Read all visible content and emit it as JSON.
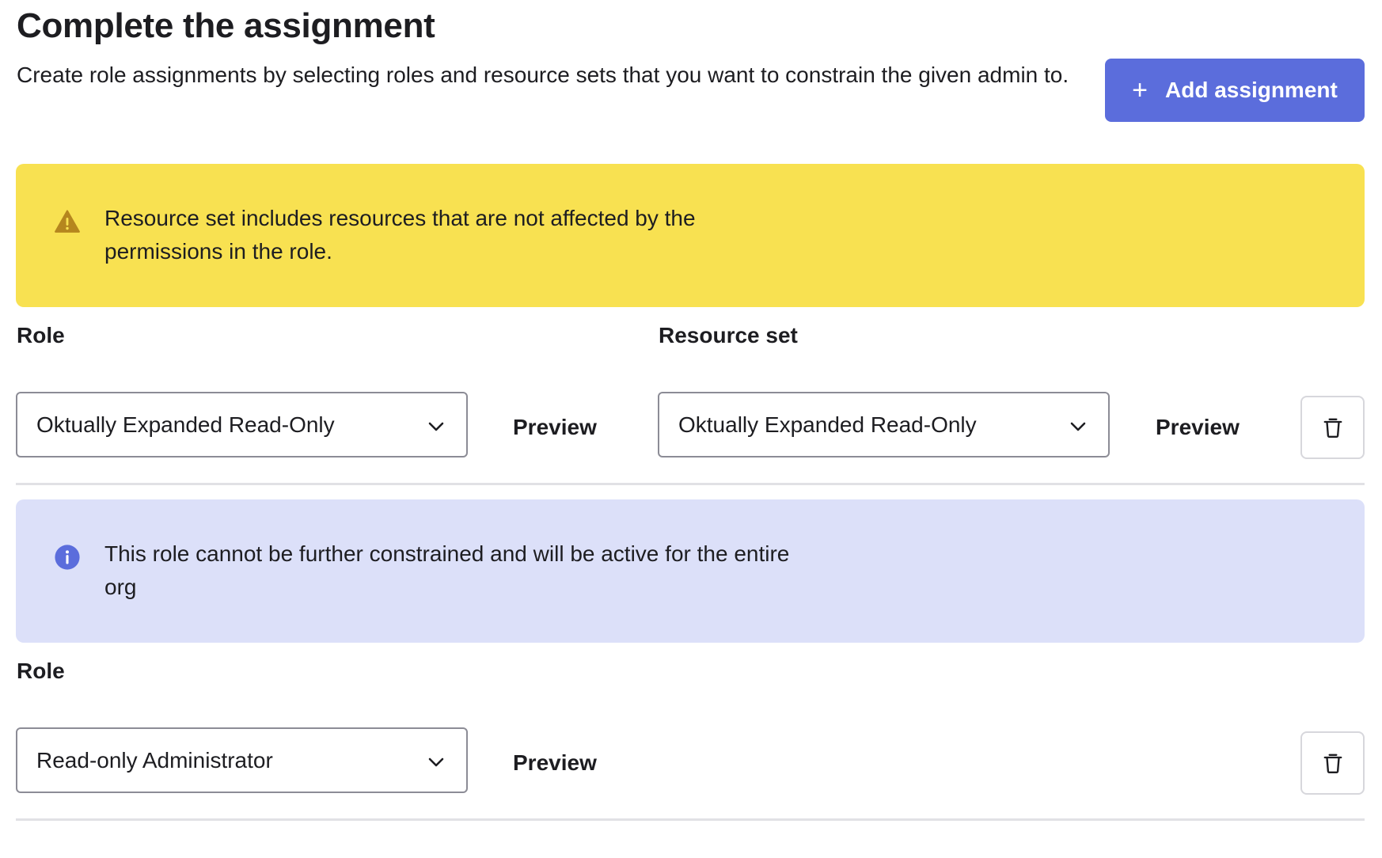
{
  "header": {
    "title": "Complete the assignment",
    "description": "Create role assignments by selecting roles and resource sets that you want to constrain the given admin to.",
    "add_button": {
      "icon": "plus-icon",
      "label": "Add assignment"
    }
  },
  "warning_callout": {
    "icon": "warning-triangle-icon",
    "text": "Resource set includes resources that are not affected by the permissions in the role."
  },
  "assignment_1": {
    "role_label": "Role",
    "role_value": "Oktually Expanded Read-Only",
    "role_preview": "Preview",
    "resource_label": "Resource set",
    "resource_value": "Oktually Expanded Read-Only",
    "resource_preview": "Preview",
    "delete_icon": "trash-icon"
  },
  "info_callout": {
    "icon": "info-circle-icon",
    "text": "This role cannot be further constrained and will be active for the entire org"
  },
  "assignment_2": {
    "role_label": "Role",
    "role_value": "Read-only Administrator",
    "role_preview": "Preview",
    "delete_icon": "trash-icon"
  },
  "colors": {
    "primary": "#5b6ddc",
    "warning_bg": "#f8e151",
    "warning_icon": "#b5861e",
    "info_bg": "#dce0f9",
    "info_icon": "#5b6ddc"
  }
}
